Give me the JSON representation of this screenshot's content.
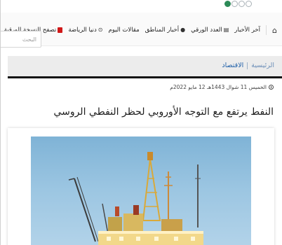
{
  "nav": {
    "home_icon": "home-icon",
    "items": [
      {
        "label": "آخر الأخبار",
        "icon": ""
      },
      {
        "label": "العدد الورقي",
        "icon": "newspaper-icon"
      },
      {
        "label": "أخبار المناطق",
        "icon": "map-pin-icon"
      },
      {
        "label": "مقالات اليوم",
        "icon": ""
      },
      {
        "label": "دنيا الرياضة",
        "icon": "ball-icon"
      },
      {
        "label": "تصفح النسخة الورقية",
        "icon": "pdf-icon"
      }
    ]
  },
  "search": {
    "placeholder": "البحث"
  },
  "breadcrumb": {
    "home": "الرئيسية",
    "section": "الاقتصاد"
  },
  "article": {
    "date": "الخميس 11 شوال 1443هـ 12 مايو 2022م",
    "title": "النفط يرتفع مع التوجه الأوروبي لحظر النفطي الروسي"
  },
  "colors": {
    "breadcrumb_section": "#1e5fa8",
    "pdf_badge": "#d01818",
    "active_dot": "#2d8a57"
  }
}
